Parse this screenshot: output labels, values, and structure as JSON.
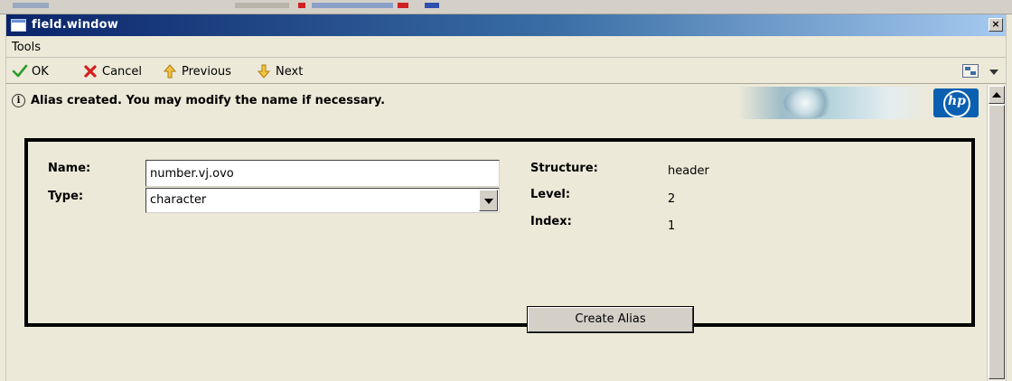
{
  "window": {
    "title": "field.window",
    "close_symbol": "×"
  },
  "menu": {
    "tools_label": "Tools"
  },
  "toolbar": {
    "ok_label": "OK",
    "cancel_label": "Cancel",
    "previous_label": "Previous",
    "next_label": "Next",
    "icons": {
      "ok": "checkmark-icon",
      "cancel": "red-x-icon",
      "previous": "up-arrow-icon",
      "next": "down-arrow-icon",
      "options": "tree-view-icon",
      "menu": "dropdown-arrow-icon"
    },
    "colors": {
      "ok": "#2a9d2a",
      "cancel": "#d42020",
      "arrows": "#e0a020"
    }
  },
  "message": {
    "text": "Alias created.  You may modify the name if necessary.",
    "icon": "info-icon"
  },
  "form": {
    "name_label": "Name:",
    "name_value": "number.vj.ovo",
    "type_label": "Type:",
    "type_value": "character",
    "structure_label": "Structure:",
    "structure_value": "header",
    "level_label": "Level:",
    "level_value": "2",
    "index_label": "Index:",
    "index_value": "1",
    "create_alias_label": "Create Alias"
  },
  "branding": {
    "logo": "hp-logo"
  }
}
